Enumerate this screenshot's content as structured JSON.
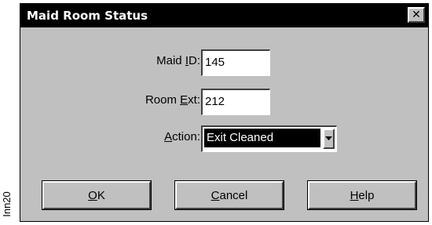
{
  "side_label": "Inn20",
  "dialog": {
    "title": "Maid Room Status",
    "close_glyph": "✕"
  },
  "form": {
    "maid_id": {
      "label_pre": "Maid ",
      "label_key": "I",
      "label_post": "D:",
      "value": "145"
    },
    "room_ext": {
      "label_pre": "Room ",
      "label_key": "E",
      "label_post": "xt:",
      "value": "212"
    },
    "action": {
      "label_pre": "",
      "label_key": "A",
      "label_post": "ction:",
      "value": "Exit Cleaned"
    }
  },
  "buttons": {
    "ok": {
      "key": "O",
      "rest": "K"
    },
    "cancel": {
      "key": "C",
      "rest": "ancel"
    },
    "help": {
      "key": "H",
      "rest": "elp"
    }
  }
}
